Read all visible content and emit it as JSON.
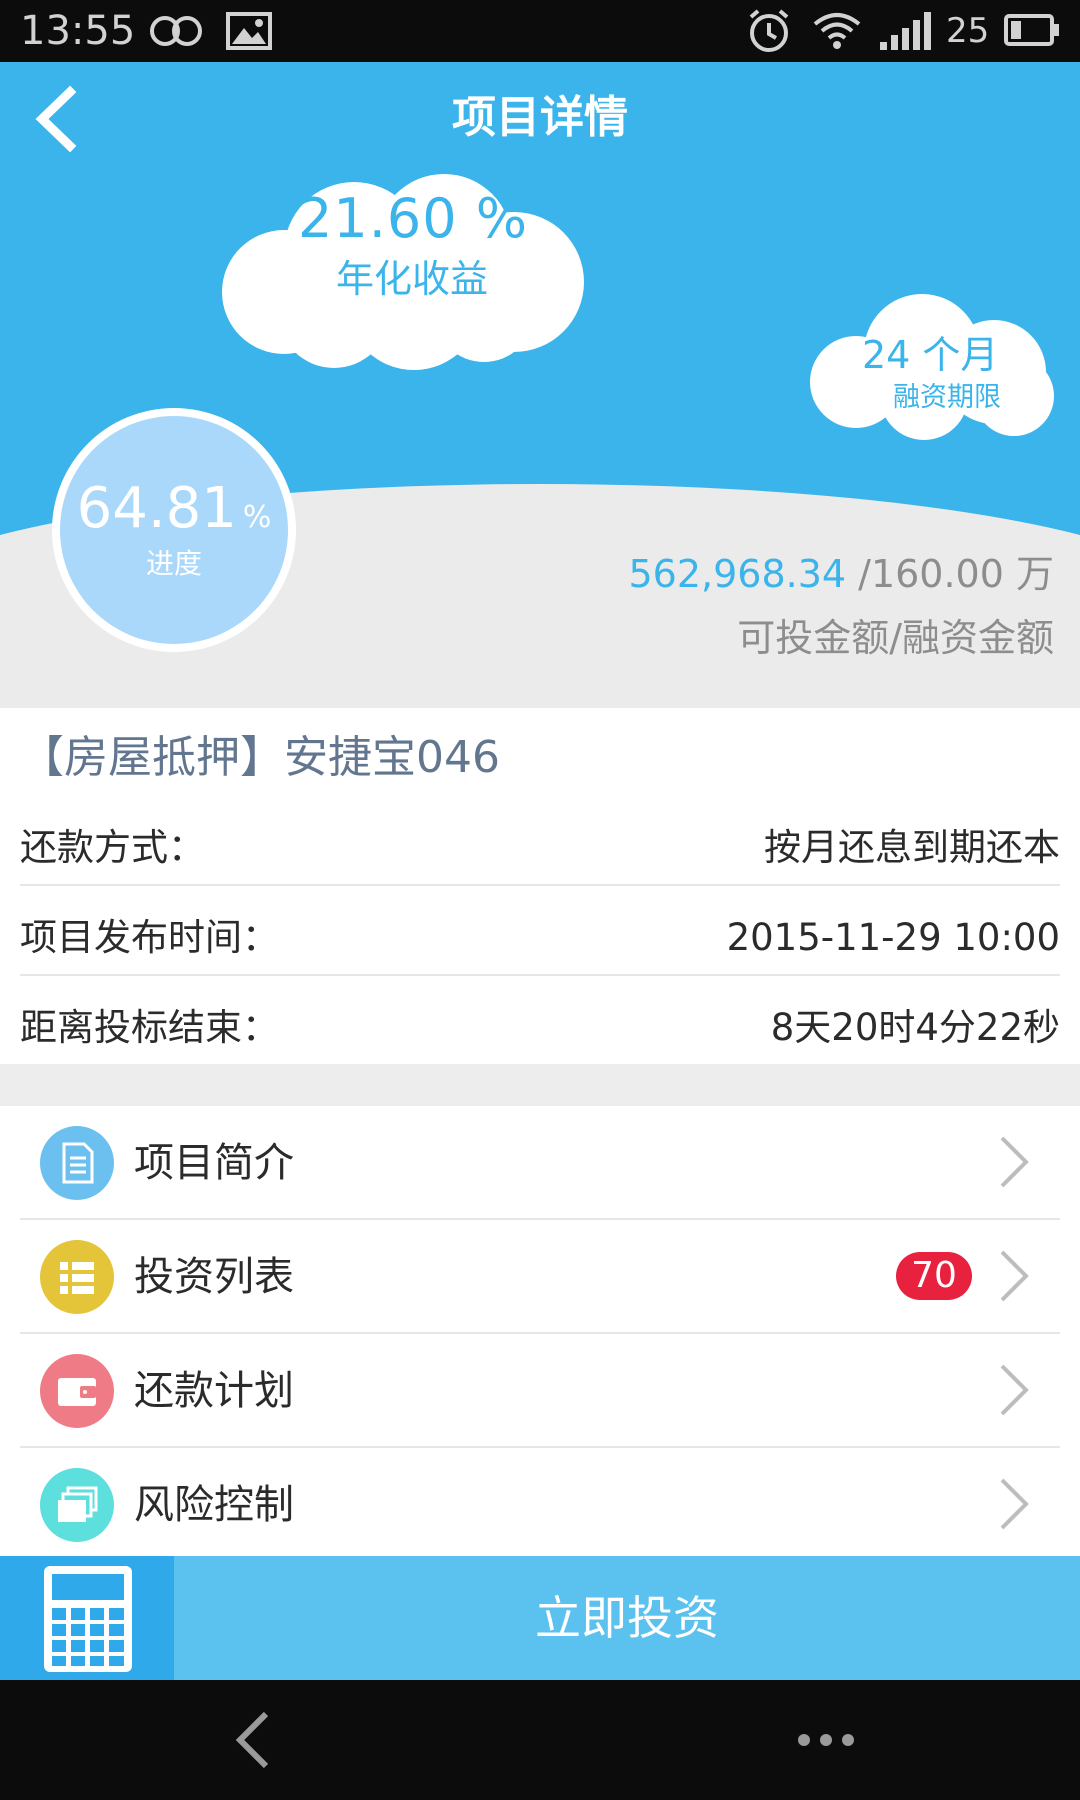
{
  "status_bar": {
    "time": "13:55",
    "battery_level": "25",
    "icons": [
      "infinity-icon",
      "image-icon",
      "alarm-icon",
      "wifi-icon",
      "signal-icon",
      "battery-icon"
    ]
  },
  "header": {
    "title": "项目详情",
    "back_icon": "chevron-left-icon"
  },
  "hero": {
    "annual_rate": "21.60 %",
    "annual_rate_label": "年化收益",
    "term": "24 个月",
    "term_label": "融资期限",
    "progress_value": "64.81",
    "progress_unit": "%",
    "progress_label": "进度",
    "available_amount": "562,968.34",
    "total_amount": " /160.00 万",
    "amounts_label": "可投金额/融资金额"
  },
  "project": {
    "name": "【房屋抵押】安捷宝046",
    "rows": [
      {
        "key": "还款方式：",
        "value": "按月还息到期还本"
      },
      {
        "key": "项目发布时间：",
        "value": "2015-11-29 10:00"
      },
      {
        "key": "距离投标结束：",
        "value": "8天20时4分22秒"
      }
    ]
  },
  "menu": {
    "items": [
      {
        "label": "项目简介",
        "icon": "document-icon",
        "color": "#6cc0ef"
      },
      {
        "label": "投资列表",
        "icon": "list-icon",
        "color": "#e4c53a",
        "badge": "70"
      },
      {
        "label": "还款计划",
        "icon": "wallet-icon",
        "color": "#ef7b86"
      },
      {
        "label": "风险控制",
        "icon": "layers-icon",
        "color": "#5ddfde"
      }
    ]
  },
  "invest": {
    "button_label": "立即投资",
    "icon": "calculator-icon"
  },
  "colors": {
    "primary": "#3ab4ea",
    "badge": "#e8213f",
    "invest_bar": "#5bc1ee"
  }
}
